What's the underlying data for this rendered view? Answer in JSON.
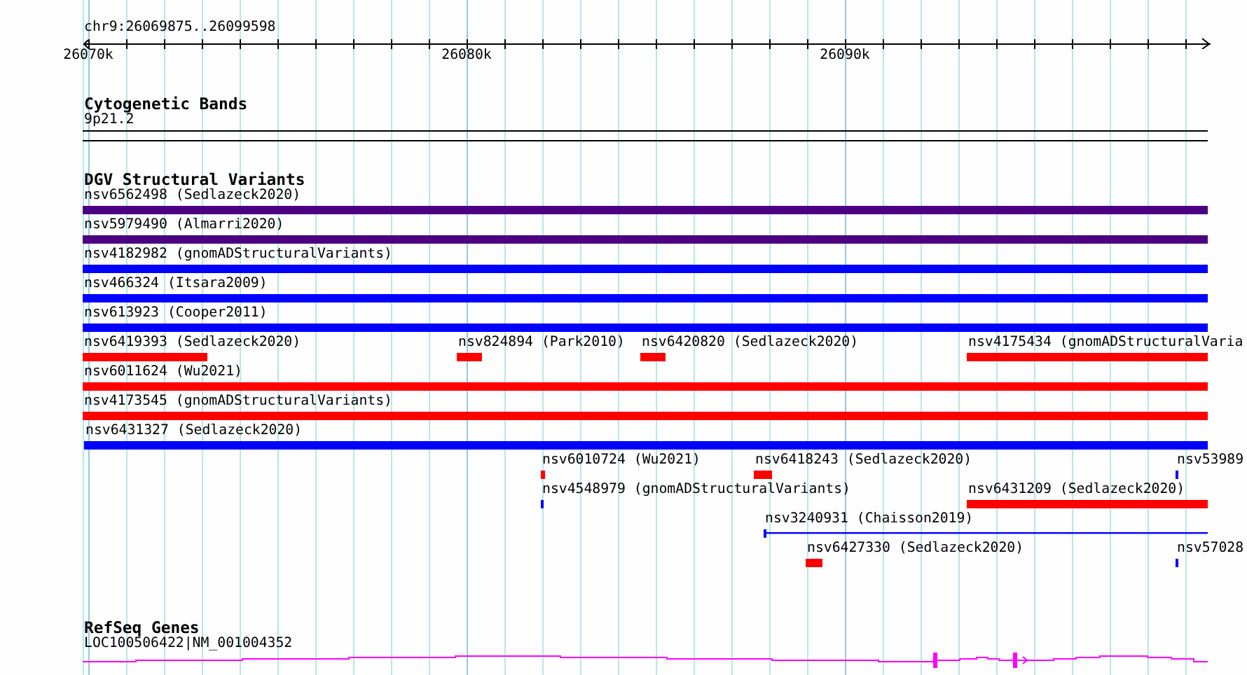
{
  "locus": "chr9:26069875..26099598",
  "axis": {
    "ticks": [
      "26070k",
      "26080k",
      "26090k"
    ]
  },
  "cytogenetic_bands": {
    "title": "Cytogenetic Bands",
    "band": "9p21.2"
  },
  "dgv_structural_variants": {
    "title": "DGV Structural Variants",
    "rows": [
      {
        "features": [
          {
            "kind": "bar",
            "label": "nsv6562498 (Sedlazeck2020)",
            "color": "#4b0082"
          }
        ]
      },
      {
        "features": [
          {
            "kind": "bar",
            "label": "nsv5979490 (Almarri2020)",
            "color": "#4b0082"
          }
        ]
      },
      {
        "features": [
          {
            "kind": "bar",
            "label": "nsv4182982 (gnomADStructuralVariants)",
            "color": "#0000ff"
          }
        ]
      },
      {
        "features": [
          {
            "kind": "bar",
            "label": "nsv466324 (Itsara2009)",
            "color": "#0000ff"
          }
        ]
      },
      {
        "features": [
          {
            "kind": "bar",
            "label": "nsv613923 (Cooper2011)",
            "color": "#0000ff"
          }
        ]
      },
      {
        "features": [
          {
            "kind": "bar",
            "label": "nsv6419393 (Sedlazeck2020)",
            "color": "#ff0000"
          },
          {
            "kind": "bar",
            "label": "nsv824894 (Park2010)",
            "color": "#ff0000"
          },
          {
            "kind": "bar",
            "label": "nsv6420820 (Sedlazeck2020)",
            "color": "#ff0000"
          },
          {
            "kind": "bar",
            "label": "nsv4175434 (gnomADStructuralVaria",
            "color": "#ff0000"
          }
        ]
      },
      {
        "features": [
          {
            "kind": "bar",
            "label": "nsv6011624 (Wu2021)",
            "color": "#ff0000"
          }
        ]
      },
      {
        "features": [
          {
            "kind": "bar",
            "label": "nsv4173545 (gnomADStructuralVariants)",
            "color": "#ff0000"
          }
        ]
      },
      {
        "features": [
          {
            "kind": "bar",
            "label": "nsv6431327 (Sedlazeck2020)",
            "color": "#0000ff"
          }
        ]
      },
      {
        "features": [
          {
            "kind": "bar",
            "label": "nsv6010724 (Wu2021)",
            "color": "#ff0000"
          },
          {
            "kind": "bar",
            "label": "nsv6418243 (Sedlazeck2020)",
            "color": "#ff0000"
          },
          {
            "kind": "bar",
            "label": "nsv53989",
            "color": "#0000ff"
          }
        ]
      },
      {
        "features": [
          {
            "kind": "bar",
            "label": "nsv4548979 (gnomADStructuralVariants)",
            "color": "#0000ff"
          },
          {
            "kind": "bar",
            "label": "nsv6431209 (Sedlazeck2020)",
            "color": "#ff0000"
          }
        ]
      },
      {
        "features": [
          {
            "kind": "line",
            "label": "nsv3240931 (Chaisson2019)",
            "color": "#0000ff"
          }
        ]
      },
      {
        "features": [
          {
            "kind": "bar",
            "label": "nsv6427330 (Sedlazeck2020)",
            "color": "#ff0000"
          },
          {
            "kind": "bar",
            "label": "nsv57028",
            "color": "#0000ff"
          }
        ]
      }
    ]
  },
  "refseq_genes": {
    "title": "RefSeq Genes",
    "gene": "LOC100506422|NM_001004352"
  }
}
